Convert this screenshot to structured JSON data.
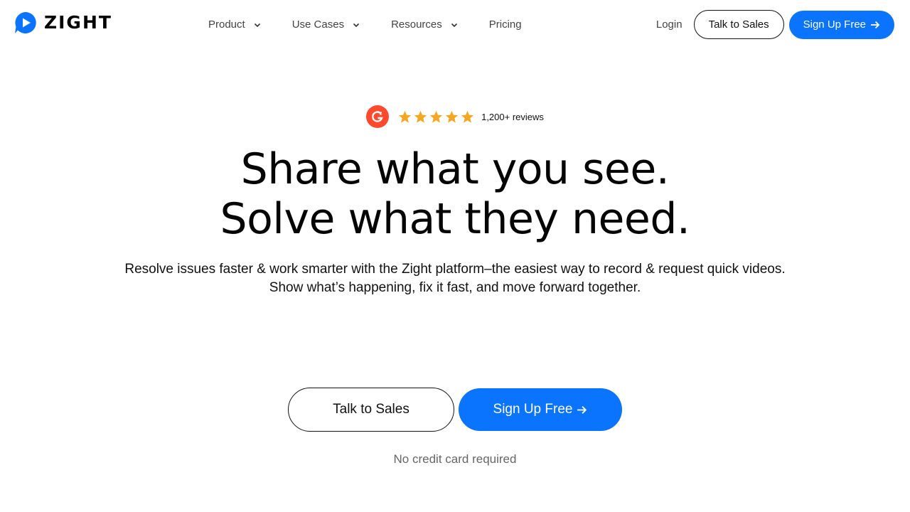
{
  "brand": {
    "name": "ZIGHT",
    "logo_icon": "chat-play-icon",
    "accent": "#0a74ff"
  },
  "nav": {
    "items": [
      {
        "label": "Product",
        "has_dropdown": true
      },
      {
        "label": "Use Cases",
        "has_dropdown": true
      },
      {
        "label": "Resources",
        "has_dropdown": true
      },
      {
        "label": "Pricing",
        "has_dropdown": false
      }
    ]
  },
  "header_actions": {
    "login": "Login",
    "talk_to_sales": "Talk to Sales",
    "sign_up": "Sign Up Free"
  },
  "rating": {
    "badge": "G2",
    "badge_color": "#ff492c",
    "stars": 5,
    "star_color": "#f5a623",
    "reviews": "1,200+ reviews"
  },
  "hero": {
    "headline_line1": "Share what you see.",
    "headline_line2": "Solve what they need.",
    "sub_line1": "Resolve issues faster & work smarter with the Zight platform–the easiest way to record & request quick videos.",
    "sub_line2": "Show what’s happening, fix it fast, and move forward together."
  },
  "cta": {
    "talk_to_sales": "Talk to Sales",
    "sign_up": "Sign Up Free",
    "note": "No credit card required"
  }
}
